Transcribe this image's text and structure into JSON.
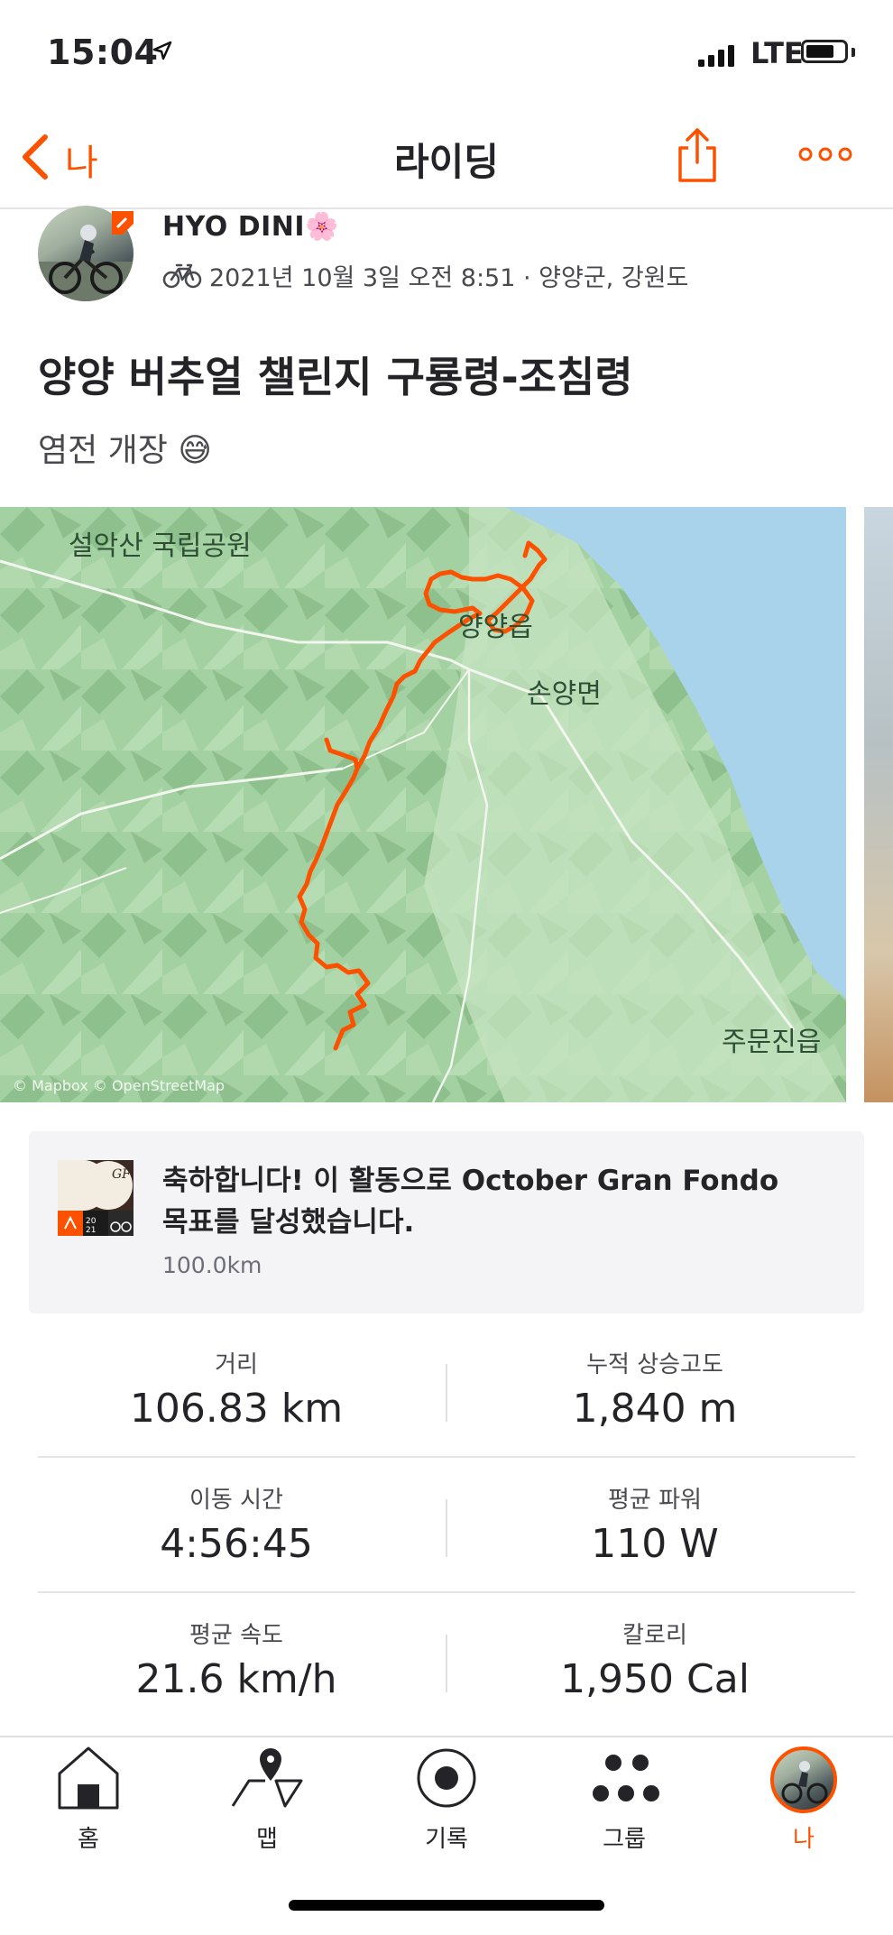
{
  "status_bar": {
    "time": "15:04",
    "network": "LTE"
  },
  "nav": {
    "back_label": "나",
    "title": "라이딩"
  },
  "activity": {
    "athlete_name": "HYO DINI",
    "athlete_emoji": "🌸",
    "meta": "2021년 10월 3일 오전 8:51 · 양양군, 강원도",
    "title": "양양 버추얼 챌린지 구룡령-조침령",
    "description": "염전 개장",
    "description_emoji": "😅"
  },
  "map": {
    "labels": {
      "park": "설악산 국립공원",
      "town": "양양읍",
      "district": "손양면",
      "south": "주문진읍"
    },
    "credit": "© Mapbox © OpenStreetMap",
    "route_color": "#fc5200"
  },
  "achievement": {
    "text": "축하합니다! 이 활동으로 October Gran Fondo 목표를 달성했습니다.",
    "goal": "100.0km",
    "badge_year": "2021"
  },
  "stats": [
    {
      "label": "거리",
      "value": "106.83 km"
    },
    {
      "label": "누적 상승고도",
      "value": "1,840 m"
    },
    {
      "label": "이동 시간",
      "value": "4:56:45"
    },
    {
      "label": "평균 파워",
      "value": "110 W"
    },
    {
      "label": "평균 속도",
      "value": "21.6 km/h"
    },
    {
      "label": "칼로리",
      "value": "1,950 Cal"
    }
  ],
  "tabs": [
    {
      "label": "홈",
      "icon": "home-icon"
    },
    {
      "label": "맵",
      "icon": "map-icon"
    },
    {
      "label": "기록",
      "icon": "record-icon"
    },
    {
      "label": "그룹",
      "icon": "groups-icon"
    },
    {
      "label": "나",
      "icon": "profile-avatar",
      "active": true
    }
  ],
  "colors": {
    "accent": "#fc5200",
    "text": "#242428",
    "secondary_text": "#494950"
  }
}
